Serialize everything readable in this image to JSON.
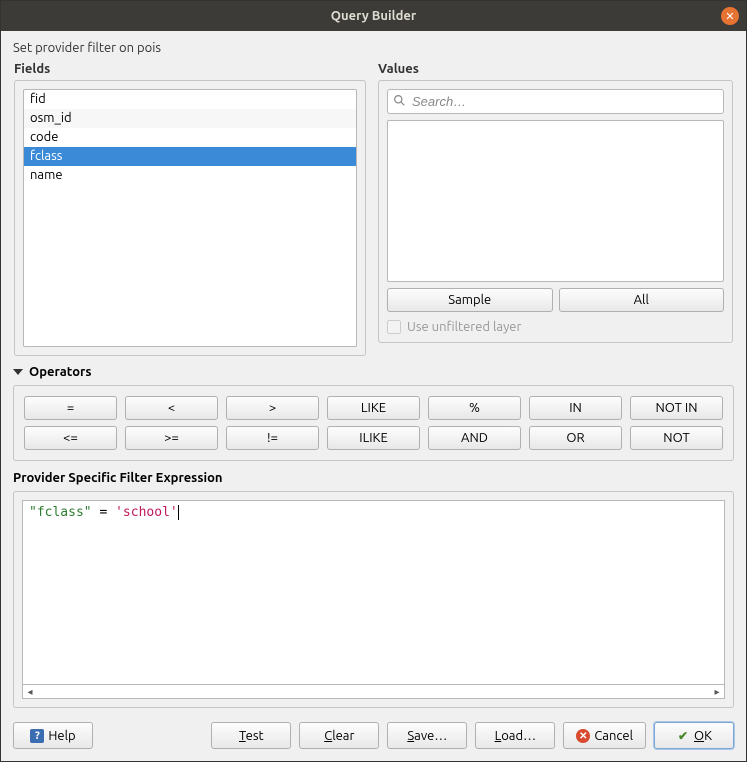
{
  "window": {
    "title": "Query Builder"
  },
  "subtitle": "Set provider filter on pois",
  "fields": {
    "label": "Fields",
    "items": [
      "fid",
      "osm_id",
      "code",
      "fclass",
      "name"
    ],
    "selected_index": 3
  },
  "values": {
    "label": "Values",
    "search_placeholder": "Search…",
    "sample_label": "Sample",
    "all_label": "All",
    "unfiltered_label": "Use unfiltered layer",
    "unfiltered_checked": false
  },
  "operators": {
    "label": "Operators",
    "row1": [
      "=",
      "<",
      ">",
      "LIKE",
      "%",
      "IN",
      "NOT IN"
    ],
    "row2": [
      "<=",
      ">=",
      "!=",
      "ILIKE",
      "AND",
      "OR",
      "NOT"
    ]
  },
  "expression": {
    "label": "Provider Specific Filter Expression",
    "text": "\"fclass\" = 'school'"
  },
  "buttons": {
    "help": "Help",
    "test": "Test",
    "clear": "Clear",
    "save": "Save…",
    "load": "Load…",
    "cancel": "Cancel",
    "ok": "OK"
  }
}
